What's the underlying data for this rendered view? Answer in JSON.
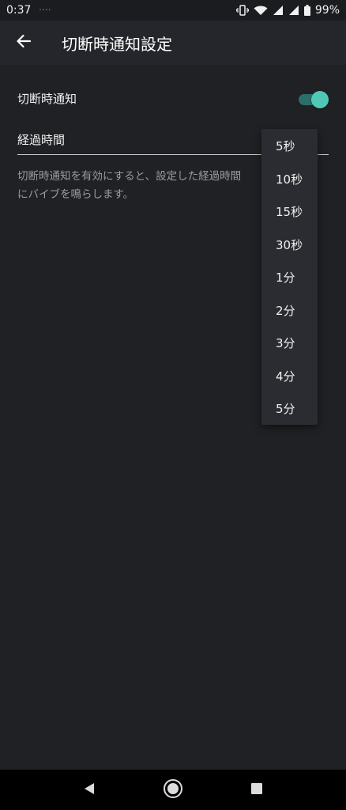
{
  "status_bar": {
    "time": "0:37",
    "notification_dots": "••••",
    "battery_percent": "99%",
    "icons": [
      "vibrate-icon",
      "wifi-icon",
      "signal-icon",
      "signal-icon",
      "battery-icon"
    ]
  },
  "app_bar": {
    "title": "切断時通知設定",
    "back_icon": "arrow-back-icon"
  },
  "settings": {
    "notify_label": "切断時通知",
    "notify_enabled": true,
    "elapsed_label": "経過時間",
    "description_line1": "切断時通知を有効にすると、設定した経過時間",
    "description_line2": "にバイブを鳴らします。"
  },
  "dropdown": {
    "options": [
      "5秒",
      "10秒",
      "15秒",
      "30秒",
      "1分",
      "2分",
      "3分",
      "4分",
      "5分"
    ]
  },
  "nav_bar": {
    "icons": [
      "back-triangle-icon",
      "home-circle-icon",
      "recents-square-icon"
    ]
  },
  "colors": {
    "background": "#202125",
    "app_bar": "#25262b",
    "accent": "#4fc9b6",
    "popup": "#2b2c31"
  }
}
